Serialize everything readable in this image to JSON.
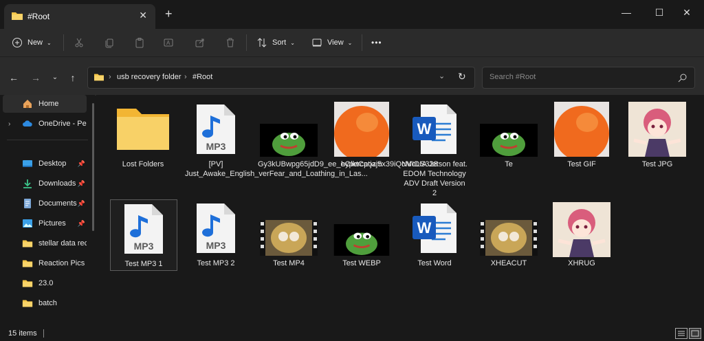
{
  "window": {
    "tab_title": "#Root",
    "new_tab_symbol": "+",
    "tab_close_symbol": "✕",
    "controls": {
      "minimize": "—",
      "maximize": "☐",
      "close": "✕"
    }
  },
  "toolbar": {
    "new_label": "New",
    "sort_label": "Sort",
    "view_label": "View",
    "more_label": "•••",
    "icons": [
      "cut-icon",
      "copy-icon",
      "paste-icon",
      "rename-icon",
      "share-icon",
      "delete-icon"
    ]
  },
  "address": {
    "crumbs": [
      "usb recovery folder",
      "#Root"
    ],
    "search_placeholder": "Search #Root"
  },
  "sidebar": {
    "items": [
      {
        "label": "Home",
        "icon": "home-icon",
        "pinned": false
      },
      {
        "label": "OneDrive - Perso",
        "icon": "cloud-icon",
        "pinned": false
      },
      {
        "label": "Desktop",
        "icon": "desktop-icon",
        "pinned": true
      },
      {
        "label": "Downloads",
        "icon": "download-icon",
        "pinned": true
      },
      {
        "label": "Documents",
        "icon": "documents-icon",
        "pinned": true
      },
      {
        "label": "Pictures",
        "icon": "pictures-icon",
        "pinned": true
      },
      {
        "label": "stellar data reco",
        "icon": "folder-icon",
        "pinned": false
      },
      {
        "label": "Reaction Pics",
        "icon": "folder-icon",
        "pinned": false
      },
      {
        "label": "23.0",
        "icon": "folder-icon",
        "pinned": false
      },
      {
        "label": "batch",
        "icon": "folder-icon",
        "pinned": false
      }
    ]
  },
  "files": [
    {
      "name": "Lost Folders",
      "type": "folder"
    },
    {
      "name": "[PV] Just_Awake_English_verFear_and_Loathing_in_Las...",
      "type": "mp3"
    },
    {
      "name": "Gy3kUBwpg65jdD9_ee_eOlktCpozj5x39iQcMoLS328",
      "type": "frog"
    },
    {
      "name": "hypercatjam",
      "type": "orange"
    },
    {
      "name": "NVIDIA Jetson feat. EDOM Technology ADV Draft Version 2",
      "type": "word"
    },
    {
      "name": "Te",
      "type": "frog"
    },
    {
      "name": "Test GIF",
      "type": "orange"
    },
    {
      "name": "Test JPG",
      "type": "anime"
    },
    {
      "name": "Test MP3 1",
      "type": "mp3"
    },
    {
      "name": "Test MP3 2",
      "type": "mp3"
    },
    {
      "name": "Test MP4",
      "type": "video"
    },
    {
      "name": "Test WEBP",
      "type": "frog"
    },
    {
      "name": "Test Word",
      "type": "word"
    },
    {
      "name": "XHEACUT",
      "type": "video"
    },
    {
      "name": "XHRUG",
      "type": "anime"
    }
  ],
  "status": {
    "item_count": "15 items"
  },
  "colors": {
    "accent_folder": "#f5c648",
    "word_blue": "#185abd",
    "mp3_blue": "#1e6fd9",
    "selection_border": "#5c5c5c"
  }
}
